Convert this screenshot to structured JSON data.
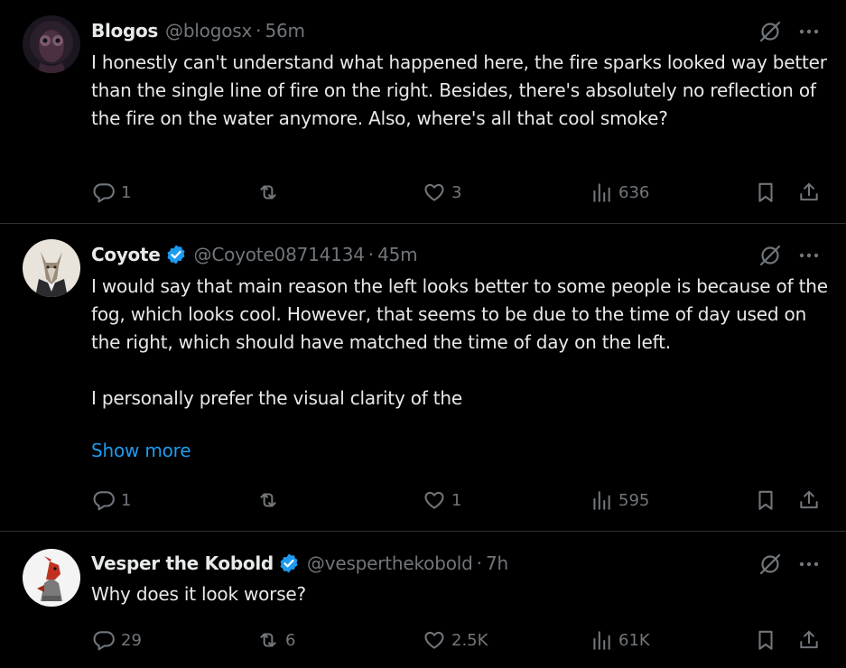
{
  "tweets": [
    {
      "name": "Blogos",
      "verified": false,
      "handle": "@blogosx",
      "time": "56m",
      "paragraphs": [
        "I honestly can't understand what happened here, the fire sparks looked way better than the single line of fire on the right. Besides, there's absolutely no reflection of the fire on the water anymore. Also, where's all that cool smoke?"
      ],
      "replies": "1",
      "reposts": "",
      "likes": "3",
      "views": "636"
    },
    {
      "name": "Coyote",
      "verified": true,
      "handle": "@Coyote08714134",
      "time": "45m",
      "paragraphs": [
        "I would say that main reason the left looks better to some people is because of the fog, which looks cool. However, that seems to be due to the time of day used on the right, which should have matched the time of day on the left.",
        "I personally prefer the visual clarity of the"
      ],
      "show_more": "Show more",
      "replies": "1",
      "reposts": "",
      "likes": "1",
      "views": "595"
    },
    {
      "name": "Vesper the Kobold",
      "verified": true,
      "handle": "@vesperthekobold",
      "time": "7h",
      "paragraphs": [
        "Why does it look worse?"
      ],
      "replies": "29",
      "reposts": "6",
      "likes": "2.5K",
      "views": "61K"
    }
  ],
  "separator": "·",
  "icons": {
    "reply": "reply-icon",
    "repost": "repost-icon",
    "like": "like-icon",
    "views": "views-icon",
    "bookmark": "bookmark-icon",
    "share": "share-icon",
    "grok": "grok-icon",
    "more": "more-icon",
    "verified": "verified-badge-icon"
  },
  "colors": {
    "background": "#000000",
    "text": "#e7e9ea",
    "secondary": "#71767b",
    "link": "#1d9bf0",
    "divider": "#2f3336"
  }
}
